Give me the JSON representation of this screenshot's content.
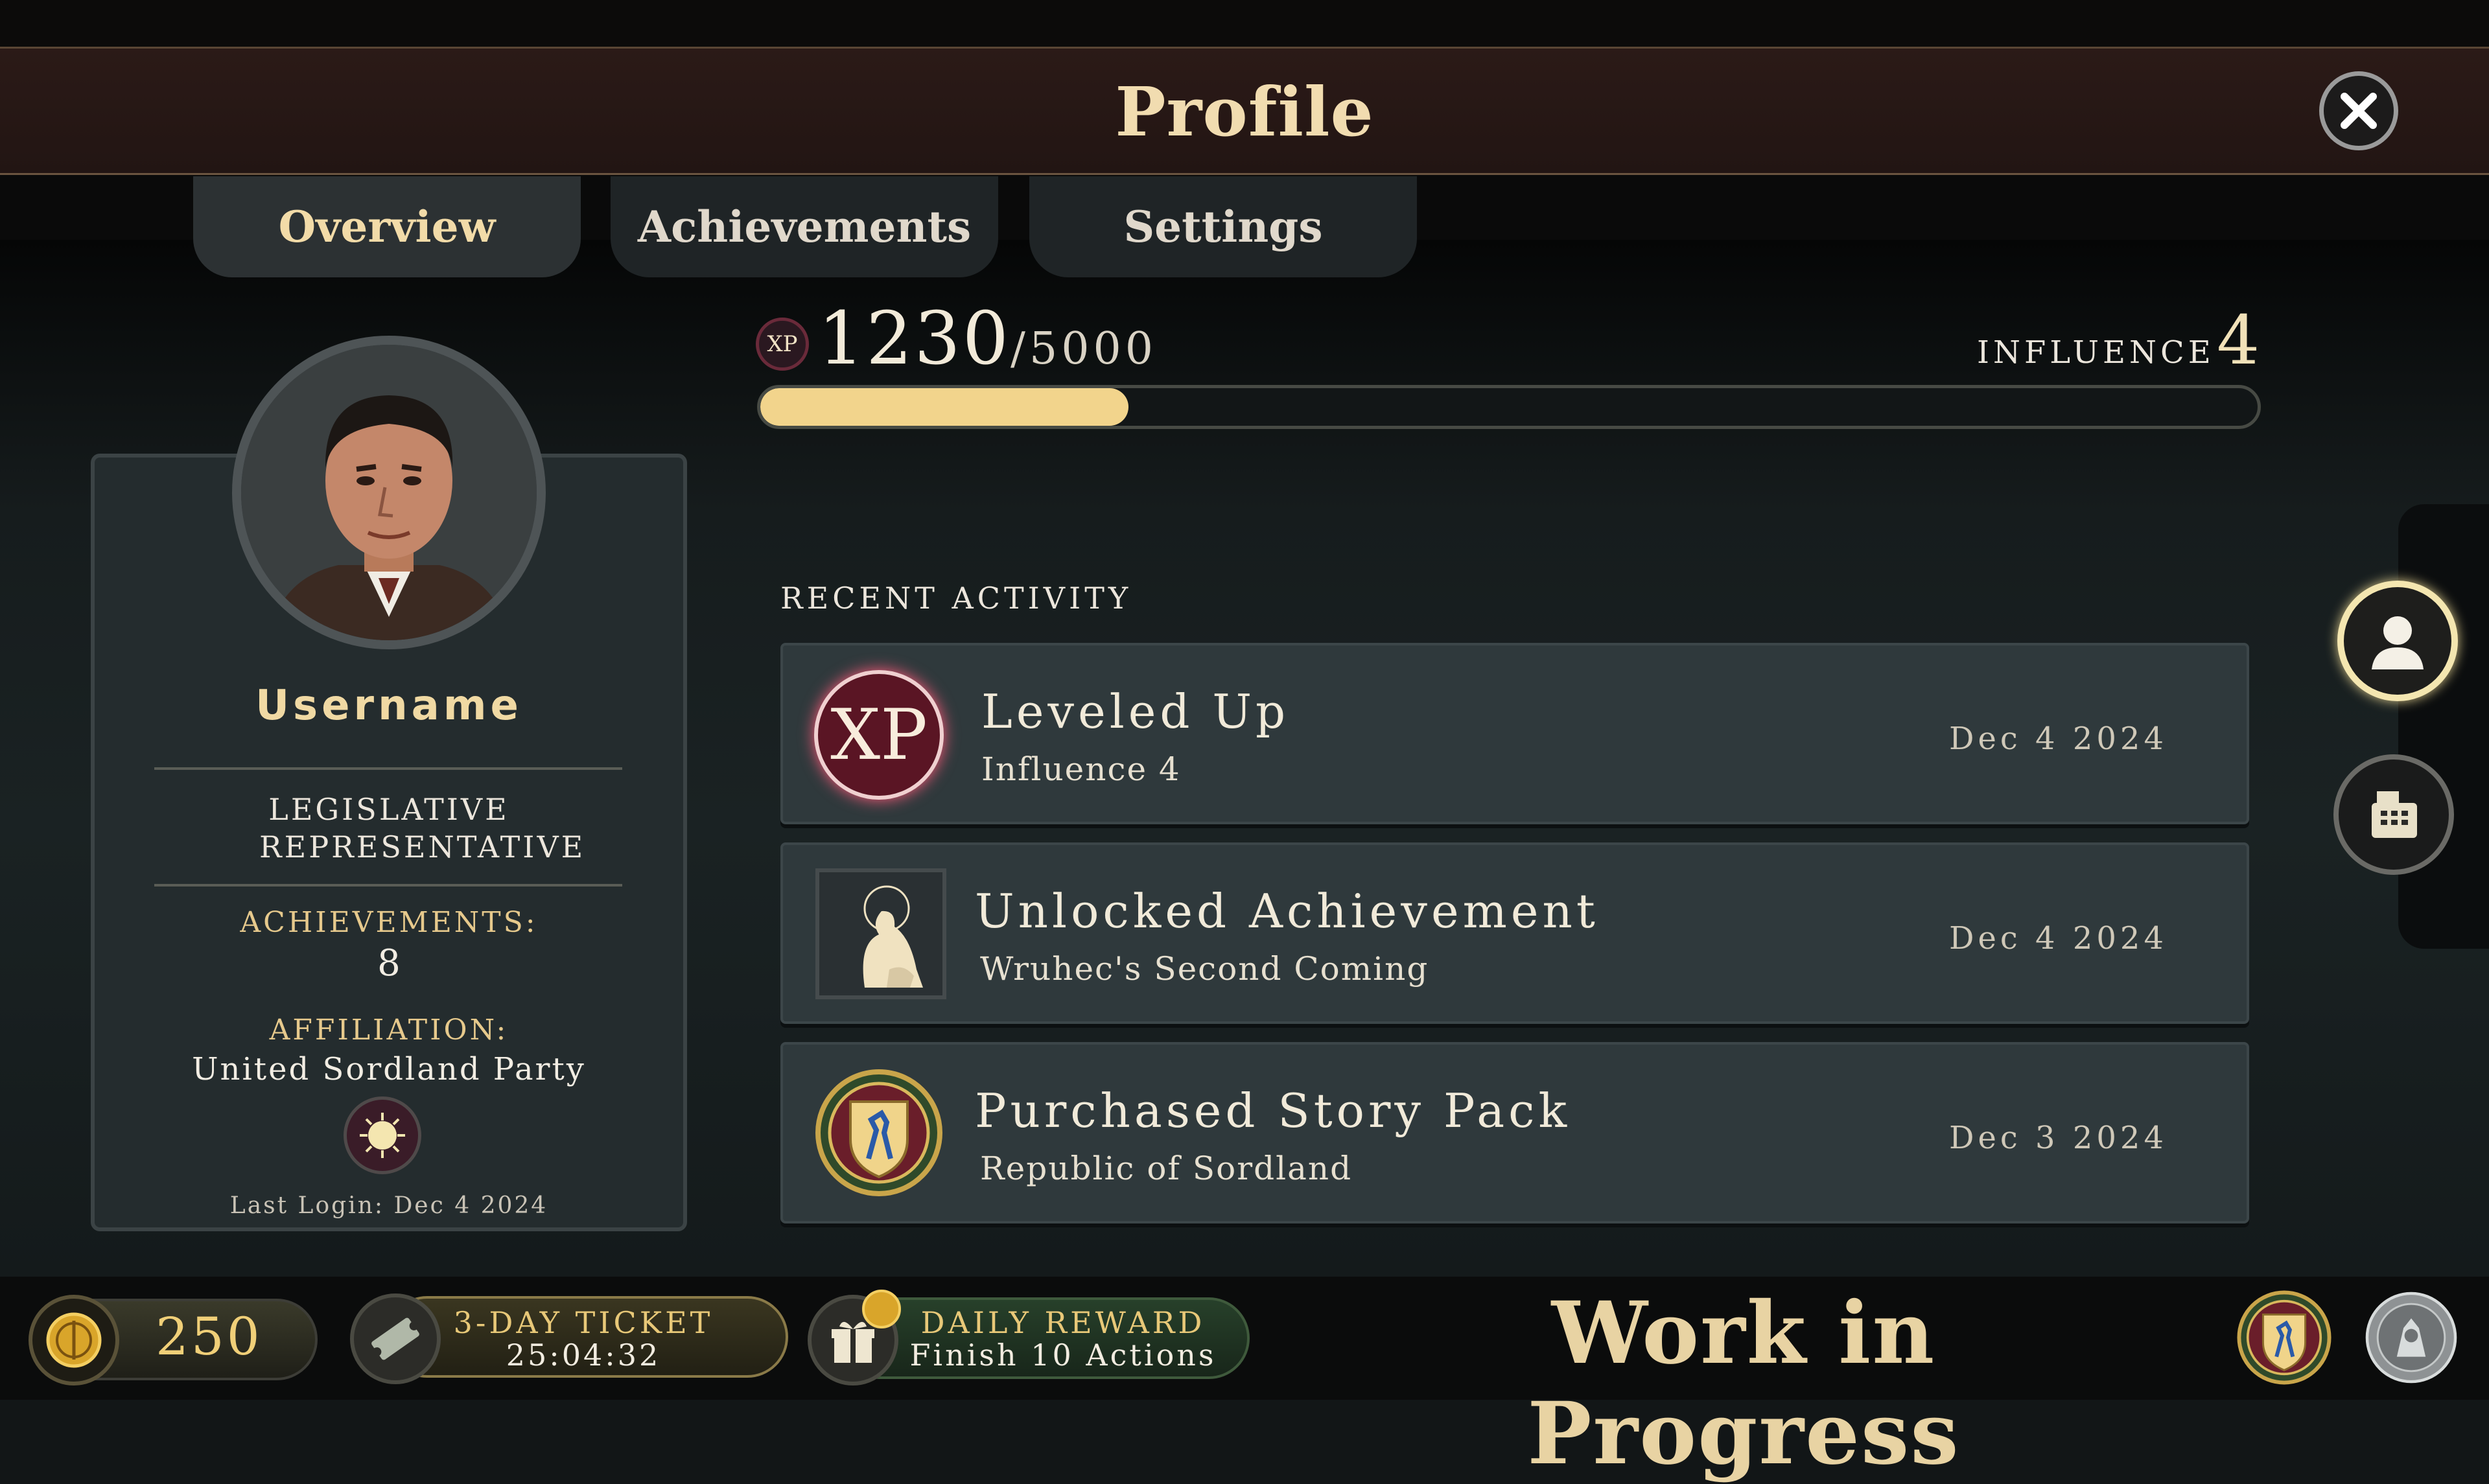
{
  "header": {
    "title": "Profile",
    "close_icon": "close-icon"
  },
  "tabs": [
    {
      "label": "Overview",
      "active": true
    },
    {
      "label": "Achievements",
      "active": false
    },
    {
      "label": "Settings",
      "active": false
    }
  ],
  "profile": {
    "username": "Username",
    "rank": "LEGISLATIVE REPRESENTATIVE",
    "achievements_label": "ACHIEVEMENTS:",
    "achievements_count": "8",
    "affiliation_label": "AFFILIATION:",
    "affiliation": "United Sordland Party",
    "last_login": "Last Login: Dec 4 2024"
  },
  "xp": {
    "badge": "XP",
    "current": "1230",
    "max": "/5000",
    "progress_fraction": 0.246,
    "influence_label": "INFLUENCE",
    "influence_value": "4"
  },
  "recent_activity": {
    "label": "RECENT ACTIVITY",
    "items": [
      {
        "icon_text": "XP",
        "title": "Leveled Up",
        "subtitle": "Influence 4",
        "date": "Dec 4 2024"
      },
      {
        "icon": "achievement-portrait-icon",
        "title": "Unlocked Achievement",
        "subtitle": "Wruhec's Second Coming",
        "date": "Dec 4 2024"
      },
      {
        "icon": "sordland-crest-icon",
        "title": "Purchased Story Pack",
        "subtitle": "Republic of Sordland",
        "date": "Dec 3 2024"
      }
    ]
  },
  "side_buttons": [
    "profile-icon",
    "shop-register-icon"
  ],
  "bottom_bar": {
    "coins": "250",
    "ticket_label": "3-DAY TICKET",
    "ticket_timer": "25:04:32",
    "reward_label": "DAILY REWARD",
    "reward_task": "Finish 10 Actions",
    "wip_text": "Work in Progress"
  },
  "colors": {
    "accent_gold": "#f2d48c",
    "header_bg": "#2b1a17",
    "panel_bg": "#2f393c",
    "xp_red": "#5a1524"
  }
}
